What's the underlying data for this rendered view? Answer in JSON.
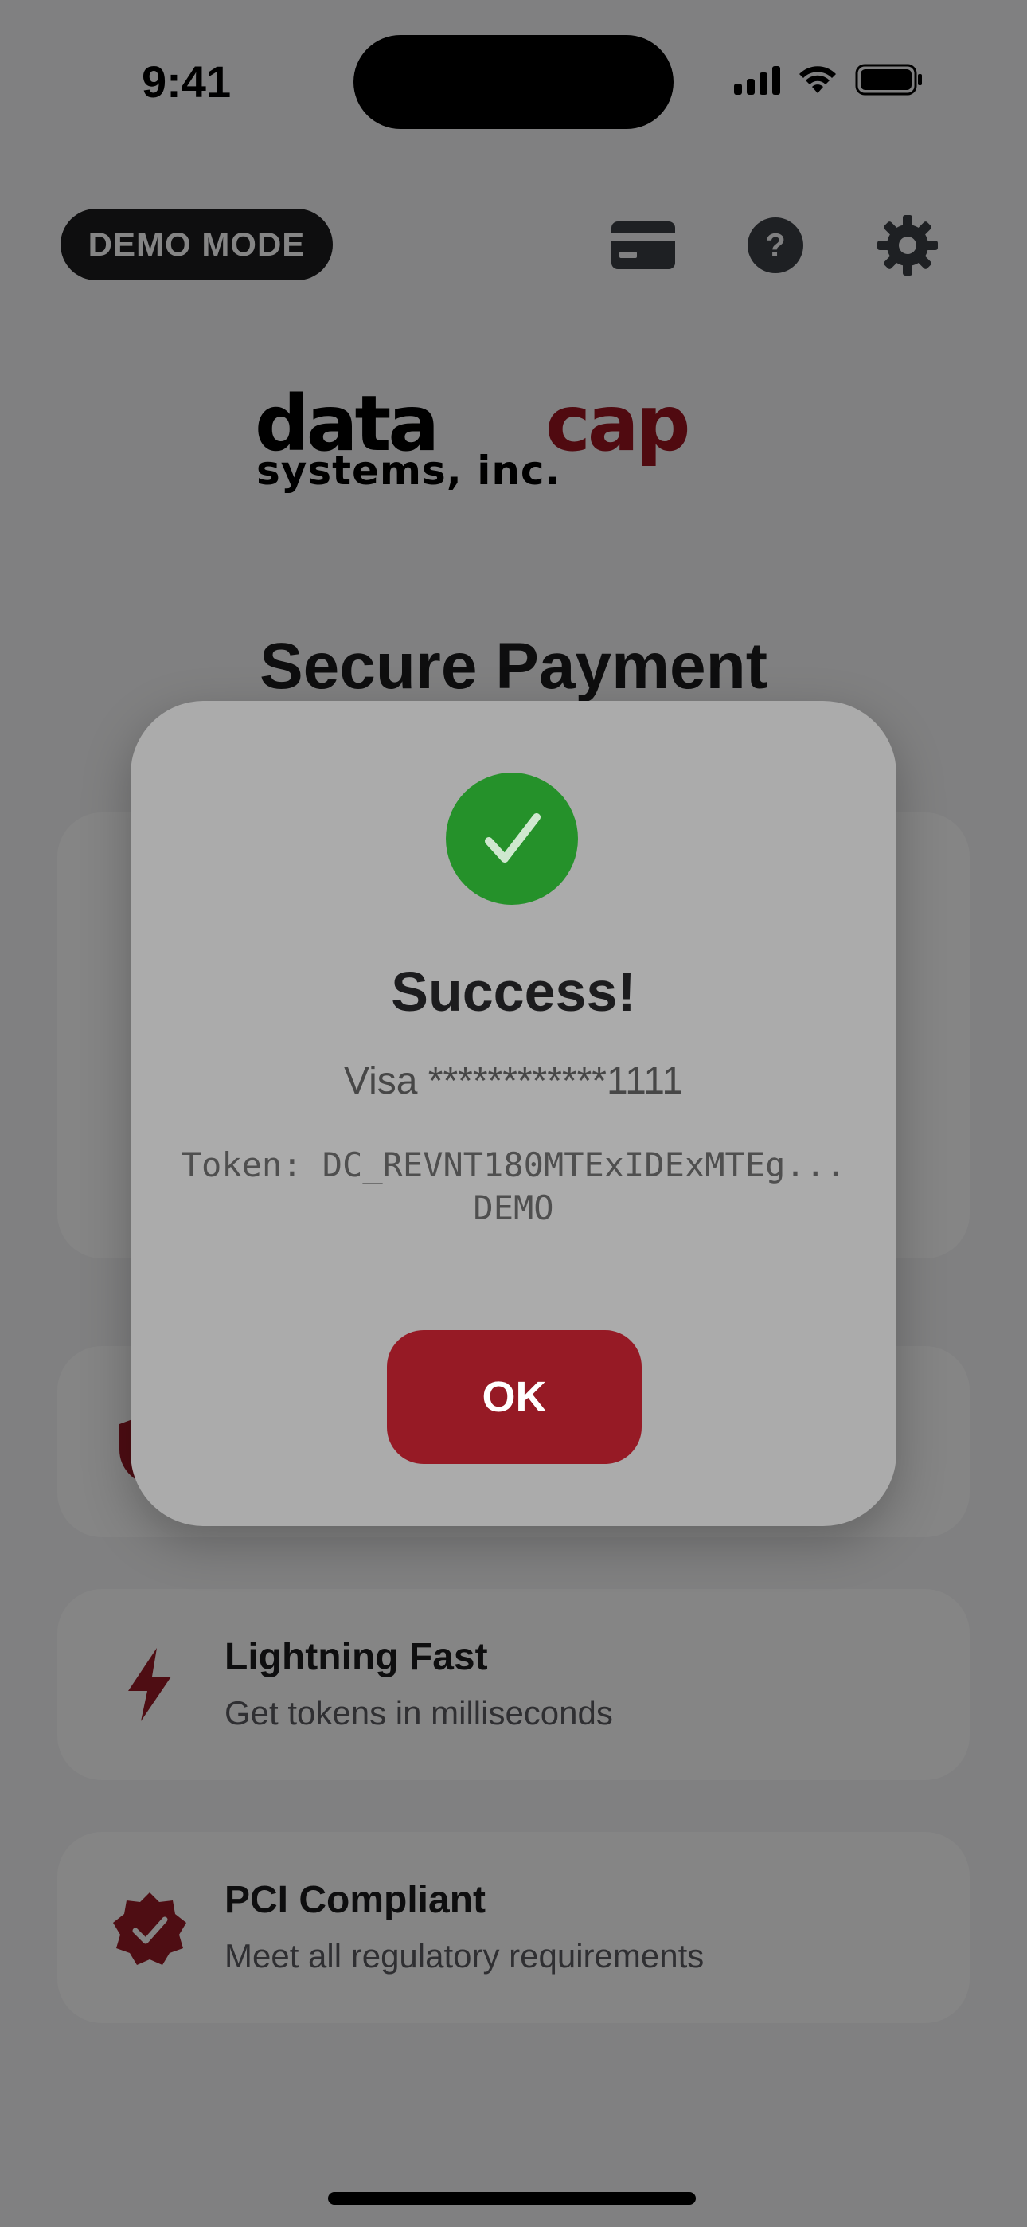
{
  "status_bar": {
    "time": "9:41"
  },
  "header": {
    "demo_badge": "DEMO MODE",
    "icons": [
      "card-icon",
      "help-icon",
      "gear-icon"
    ]
  },
  "logo": {
    "line1": "datacap",
    "line2": "systems, inc."
  },
  "page": {
    "title": "Secure Payment"
  },
  "features": [
    {
      "icon": "shield-icon",
      "title": "",
      "desc": ""
    },
    {
      "icon": "lightning-icon",
      "title": "Lightning Fast",
      "desc": "Get tokens in milliseconds"
    },
    {
      "icon": "verified-badge-icon",
      "title": "PCI Compliant",
      "desc": "Meet all regulatory requirements"
    }
  ],
  "dialog": {
    "title": "Success!",
    "card": "Visa ************1111",
    "token": "Token: DC_REVNT180MTExIDExMTEg...DEMO",
    "ok_label": "OK"
  },
  "colors": {
    "brand_red": "#961a25",
    "success_green": "#25912a",
    "badge_bg": "#1c1c1e"
  }
}
